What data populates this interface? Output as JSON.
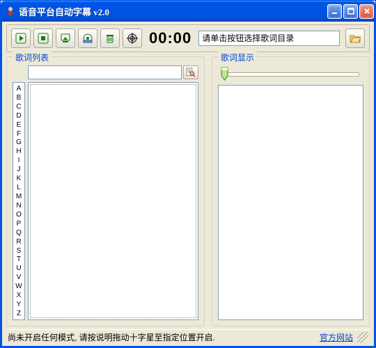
{
  "window": {
    "title": "语音平台自动字幕  v2.0"
  },
  "toolbar": {
    "timer": "00:00",
    "pathPlaceholder": "请单击按钮选择歌词目录"
  },
  "panels": {
    "leftTitle": "歌词列表",
    "rightTitle": "歌词显示"
  },
  "alphabet": [
    "A",
    "B",
    "C",
    "D",
    "E",
    "F",
    "G",
    "H",
    "I",
    "J",
    "K",
    "L",
    "M",
    "N",
    "O",
    "P",
    "Q",
    "R",
    "S",
    "T",
    "U",
    "V",
    "W",
    "X",
    "Y",
    "Z"
  ],
  "status": {
    "message": "尚未开启任何模式, 请按说明拖动十字星至指定位置开启.",
    "link": "官方网站"
  },
  "colors": {
    "accent": "#0054e3",
    "panel": "#ece9d8",
    "toolStroke": "#1a7a1a"
  }
}
